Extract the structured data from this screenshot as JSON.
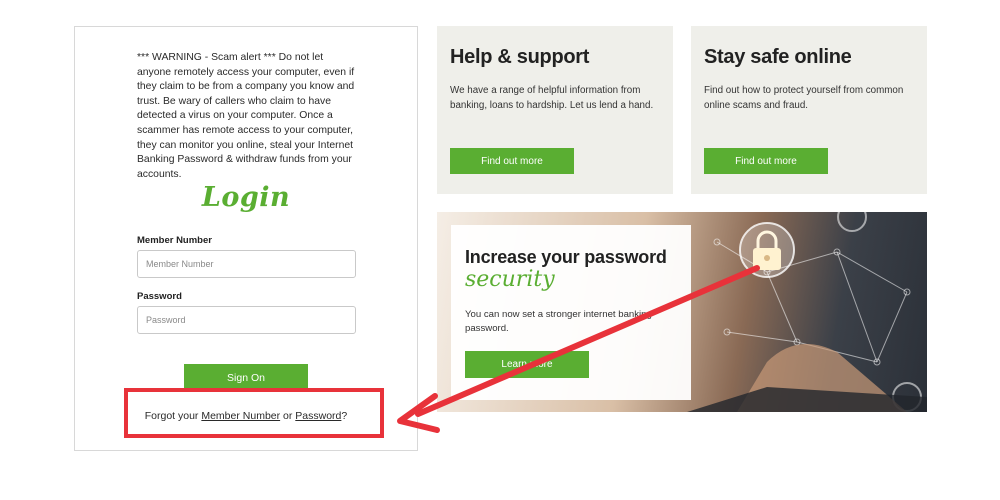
{
  "login": {
    "warning": "*** WARNING - Scam alert *** Do not let anyone remotely access your computer, even if they claim to be from a company you know and trust. Be wary of callers who claim to have detected a virus on your computer. Once a scammer has remote access to your computer, they can monitor you online, steal your Internet Banking Password & withdraw funds from your accounts.",
    "title": "Login",
    "member_label": "Member Number",
    "member_placeholder": "Member Number",
    "password_label": "Password",
    "password_placeholder": "Password",
    "signon_label": "Sign On",
    "forgot_prefix": "Forgot your ",
    "forgot_member_link": "Member Number",
    "forgot_or": " or ",
    "forgot_password_link": "Password",
    "forgot_suffix": "?"
  },
  "help_panel": {
    "title": "Help & support",
    "body": "We have a range of helpful information from banking, loans to hardship. Let us lend a hand.",
    "button": "Find out more"
  },
  "safe_panel": {
    "title": "Stay safe online",
    "body": "Find out how to protect yourself from common online scams and fraud.",
    "button": "Find out more"
  },
  "banner": {
    "title": "Increase your password",
    "script": "security",
    "body": "You can now set a stronger internet banking password.",
    "button": "Learn more"
  },
  "colors": {
    "accent_green": "#5aae32",
    "annotation_red": "#e8323a",
    "panel_bg": "#efefea"
  },
  "icons": [
    "padlock-icon",
    "annotation-arrow"
  ]
}
